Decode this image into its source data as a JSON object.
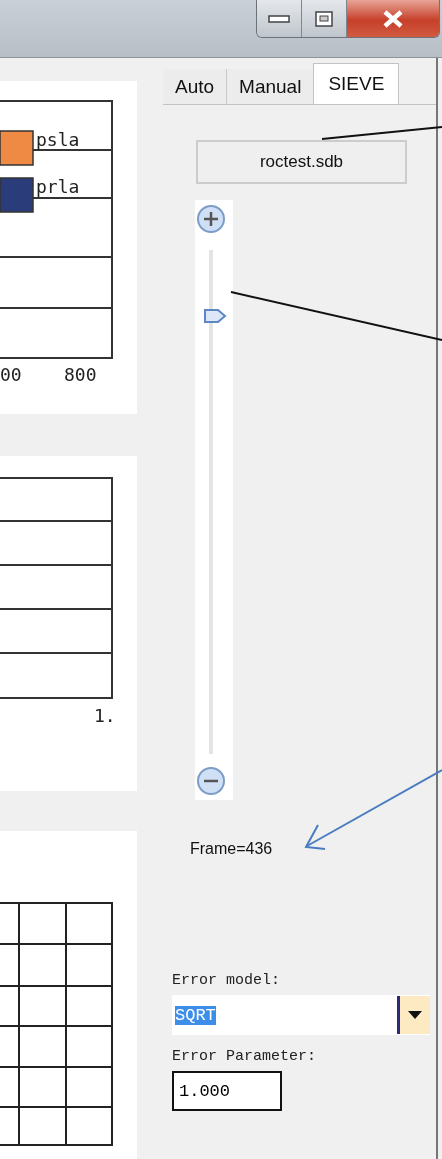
{
  "window": {
    "controls": [
      {
        "kind": "minimize"
      },
      {
        "kind": "maximize"
      },
      {
        "kind": "close"
      }
    ]
  },
  "chart_panels": [
    {
      "kind": "bars",
      "legend": [
        {
          "label": "psla",
          "color": "#ee8a44"
        },
        {
          "label": "prla",
          "color": "#2a3d7a"
        }
      ],
      "tick_labels": [
        "00",
        "800"
      ]
    },
    {
      "kind": "rows",
      "tick_labels": [
        "1."
      ]
    },
    {
      "kind": "grid"
    }
  ],
  "tabs": [
    {
      "label": "Auto",
      "selected": false
    },
    {
      "label": "Manual",
      "selected": false
    },
    {
      "label": "SIEVE",
      "selected": true
    }
  ],
  "file_button": "roctest.sdb",
  "slider": {
    "level": 0.87
  },
  "frame_label": "Frame=436",
  "error_model": {
    "label": "Error model:",
    "value": "SQRT",
    "text_selected": true
  },
  "error_parameter": {
    "label": "Error Parameter:",
    "value": "1.000"
  }
}
